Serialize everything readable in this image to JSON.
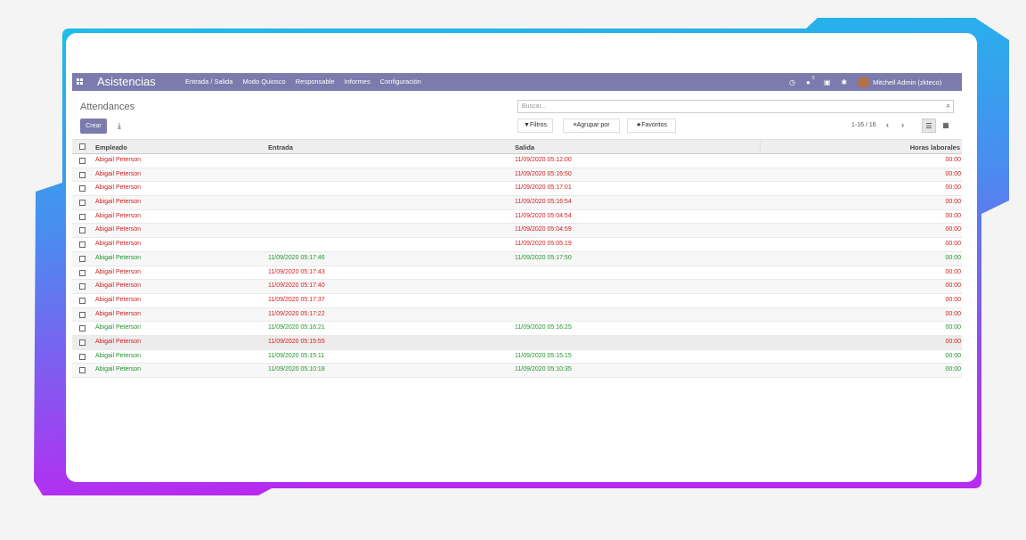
{
  "colors": {
    "navbar": "#7c7bad",
    "accent_red": "#d02020",
    "accent_green": "#20952a",
    "frame_gradient_top": "#19c0ea",
    "frame_gradient_bottom": "#b62cf0"
  },
  "navbar": {
    "apps_icon": "apps-grid-icon",
    "app_title": "Asistencias",
    "menu": [
      "Entrada / Salida",
      "Modo Quiosco",
      "Responsable",
      "Informes",
      "Configuración"
    ],
    "clock_icon": "clock-icon",
    "chat_icon": "chat-icon",
    "chat_count": "5",
    "gift_icon": "gift-icon",
    "bug_icon": "bug-icon",
    "user": "Mitchell Admin (zkteco)"
  },
  "control_panel": {
    "breadcrumb": "Attendances",
    "create_label": "Crear",
    "download_icon": "download-icon",
    "search_placeholder": "Buscar...",
    "search_icon": "search-icon",
    "filters_label": "Filtros",
    "groupby_label": "Agrupar por",
    "favorites_label": "Favoritos",
    "pager": "1-16 / 16",
    "list_view_icon": "list-view-icon",
    "kanban_view_icon": "kanban-view-icon"
  },
  "table": {
    "headers": {
      "employee": "Empleado",
      "check_in": "Entrada",
      "check_out": "Salida",
      "hours": "Horas laborales"
    },
    "rows": [
      {
        "employee": "Abigail Peterson",
        "check_in": "",
        "check_out": "11/09/2020 05:12:00",
        "hours": "00:00",
        "status": "red"
      },
      {
        "employee": "Abigail Peterson",
        "check_in": "",
        "check_out": "11/09/2020 05:16:50",
        "hours": "00:00",
        "status": "red"
      },
      {
        "employee": "Abigail Peterson",
        "check_in": "",
        "check_out": "11/09/2020 05:17:01",
        "hours": "00:00",
        "status": "red"
      },
      {
        "employee": "Abigail Peterson",
        "check_in": "",
        "check_out": "11/09/2020 05:16:54",
        "hours": "00:00",
        "status": "red"
      },
      {
        "employee": "Abigail Peterson",
        "check_in": "",
        "check_out": "11/09/2020 05:04:54",
        "hours": "00:00",
        "status": "red"
      },
      {
        "employee": "Abigail Peterson",
        "check_in": "",
        "check_out": "11/09/2020 05:04:59",
        "hours": "00:00",
        "status": "red"
      },
      {
        "employee": "Abigail Peterson",
        "check_in": "",
        "check_out": "11/09/2020 05:05:19",
        "hours": "00:00",
        "status": "red"
      },
      {
        "employee": "Abigail Peterson",
        "check_in": "11/09/2020 05:17:46",
        "check_out": "11/09/2020 05:17:50",
        "hours": "00:00",
        "status": "green"
      },
      {
        "employee": "Abigail Peterson",
        "check_in": "11/09/2020 05:17:43",
        "check_out": "",
        "hours": "00:00",
        "status": "red"
      },
      {
        "employee": "Abigail Peterson",
        "check_in": "11/09/2020 05:17:40",
        "check_out": "",
        "hours": "00:00",
        "status": "red"
      },
      {
        "employee": "Abigail Peterson",
        "check_in": "11/09/2020 05:17:37",
        "check_out": "",
        "hours": "00:00",
        "status": "red"
      },
      {
        "employee": "Abigail Peterson",
        "check_in": "11/09/2020 05:17:22",
        "check_out": "",
        "hours": "00:00",
        "status": "red"
      },
      {
        "employee": "Abigail Peterson",
        "check_in": "11/09/2020 05:16:21",
        "check_out": "11/09/2020 05:16:25",
        "hours": "00:00",
        "status": "green"
      },
      {
        "employee": "Abigail Peterson",
        "check_in": "11/09/2020 05:15:55",
        "check_out": "",
        "hours": "00:00",
        "status": "red"
      },
      {
        "employee": "Abigail Peterson",
        "check_in": "11/09/2020 05:15:11",
        "check_out": "11/09/2020 05:15:15",
        "hours": "00:00",
        "status": "green"
      },
      {
        "employee": "Abigail Peterson",
        "check_in": "11/09/2020 05:10:18",
        "check_out": "11/09/2020 05:10:35",
        "hours": "00:00",
        "status": "green"
      }
    ]
  }
}
